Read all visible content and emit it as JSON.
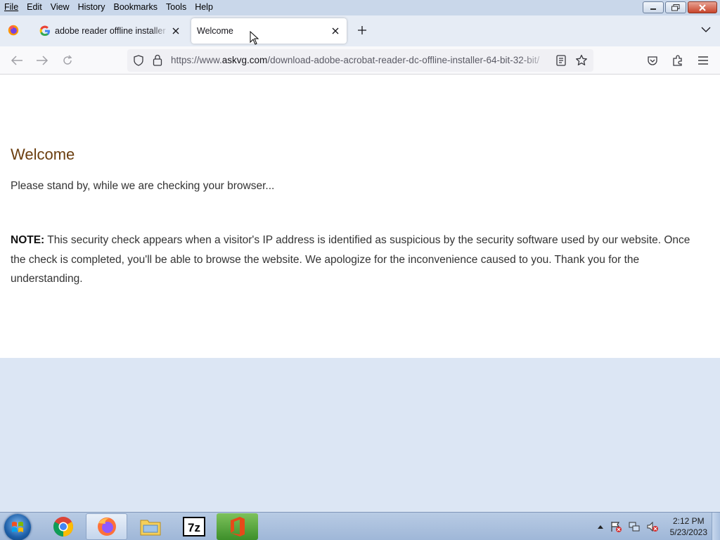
{
  "menubar": {
    "items": [
      "File",
      "Edit",
      "View",
      "History",
      "Bookmarks",
      "Tools",
      "Help"
    ]
  },
  "tabs": {
    "inactive_label": "adobe reader offline installer - Google Search",
    "active_label": "Welcome"
  },
  "navbar": {
    "url_prefix": "https://www.",
    "url_host": "askvg.com",
    "url_path": "/download-adobe-acrobat-reader-dc-offline-installer-64-bit-32-bit/"
  },
  "page": {
    "heading": "Welcome",
    "standby": "Please stand by, while we are checking your browser...",
    "note_label": "NOTE:",
    "note_text": " This security check appears when a visitor's IP address is identified as suspicious by the security software used by our website. Once the check is completed, you'll be able to browse the website. We apologize for the inconvenience caused to you. Thank you for the understanding."
  },
  "taskbar": {
    "items": [
      "chrome",
      "firefox",
      "file-explorer",
      "7zip",
      "office"
    ],
    "time": "2:12 PM",
    "date": "5/23/2023"
  },
  "colors": {
    "heading": "#6b3e0f",
    "page_bg": "#ffffff",
    "desktop_bg": "#dce6f4"
  }
}
